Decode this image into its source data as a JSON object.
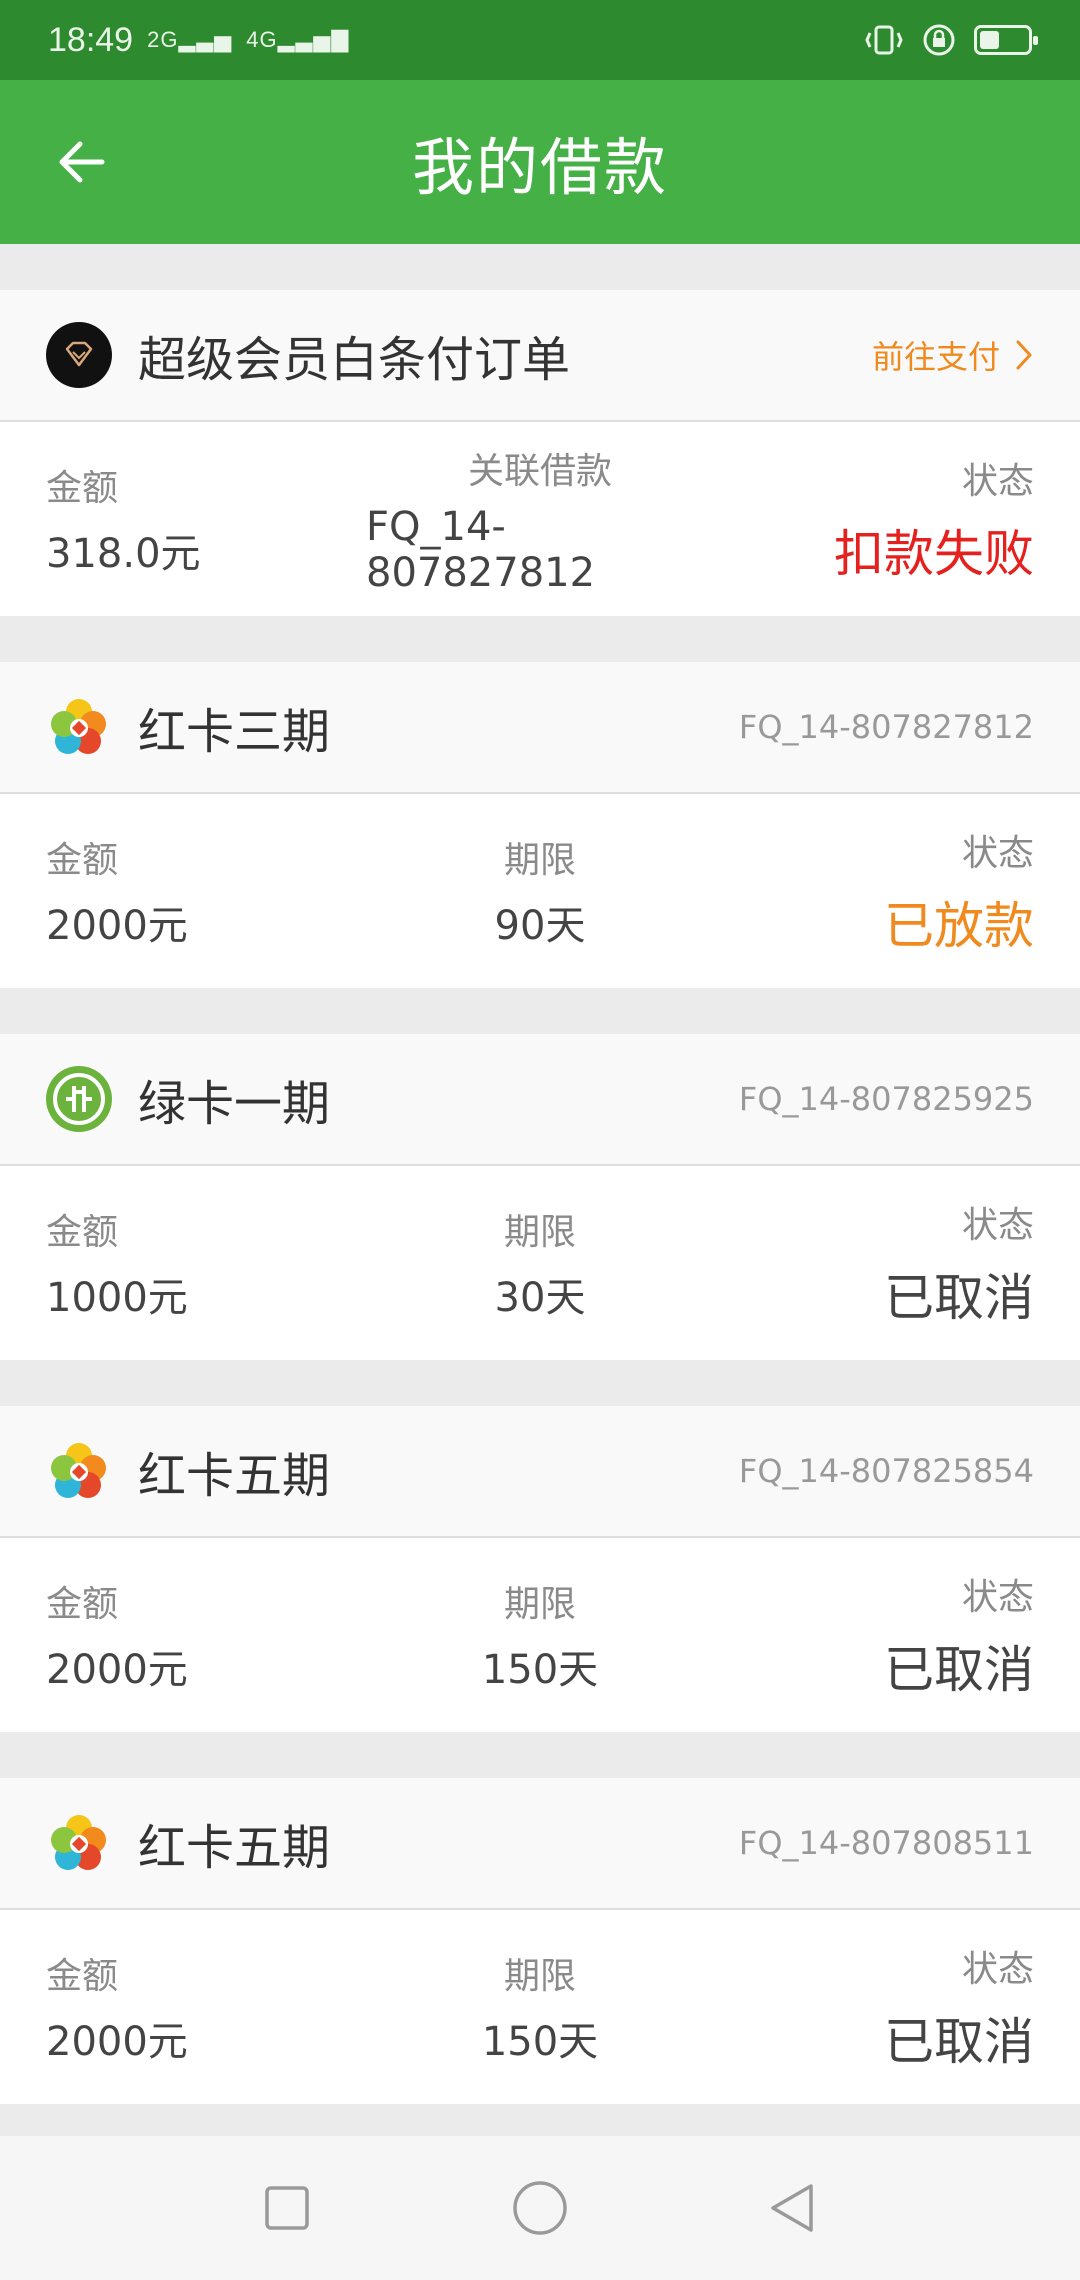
{
  "status_bar": {
    "time": "18:49",
    "signal1": "2G",
    "signal2": "4G"
  },
  "header": {
    "title": "我的借款"
  },
  "cards": [
    {
      "title": "超级会员白条付订单",
      "right_text": "前往支付",
      "icon": "diamond-vip-icon",
      "col1_label": "金额",
      "col1_value": "318.0元",
      "col2_label": "关联借款",
      "col2_value": "FQ_14-807827812",
      "col3_label": "状态",
      "col3_value": "扣款失败",
      "status_color": "#e4211f"
    },
    {
      "title": "红卡三期",
      "right_text": "FQ_14-807827812",
      "icon": "red-card-logo-icon",
      "col1_label": "金额",
      "col1_value": "2000元",
      "col2_label": "期限",
      "col2_value": "90天",
      "col3_label": "状态",
      "col3_value": "已放款",
      "status_color": "#f08a1e"
    },
    {
      "title": "绿卡一期",
      "right_text": "FQ_14-807825925",
      "icon": "green-card-logo-icon",
      "col1_label": "金额",
      "col1_value": "1000元",
      "col2_label": "期限",
      "col2_value": "30天",
      "col3_label": "状态",
      "col3_value": "已取消",
      "status_color": "#444444"
    },
    {
      "title": "红卡五期",
      "right_text": "FQ_14-807825854",
      "icon": "red-card-logo-icon",
      "col1_label": "金额",
      "col1_value": "2000元",
      "col2_label": "期限",
      "col2_value": "150天",
      "col3_label": "状态",
      "col3_value": "已取消",
      "status_color": "#444444"
    },
    {
      "title": "红卡五期",
      "right_text": "FQ_14-807808511",
      "icon": "red-card-logo-icon",
      "col1_label": "金额",
      "col1_value": "2000元",
      "col2_label": "期限",
      "col2_value": "150天",
      "col3_label": "状态",
      "col3_value": "已取消",
      "status_color": "#444444"
    }
  ],
  "colors": {
    "brand_green": "#45b045",
    "status_bar_green": "#2e8a2e",
    "pay_orange": "#f08a1e",
    "fail_red": "#e4211f"
  }
}
